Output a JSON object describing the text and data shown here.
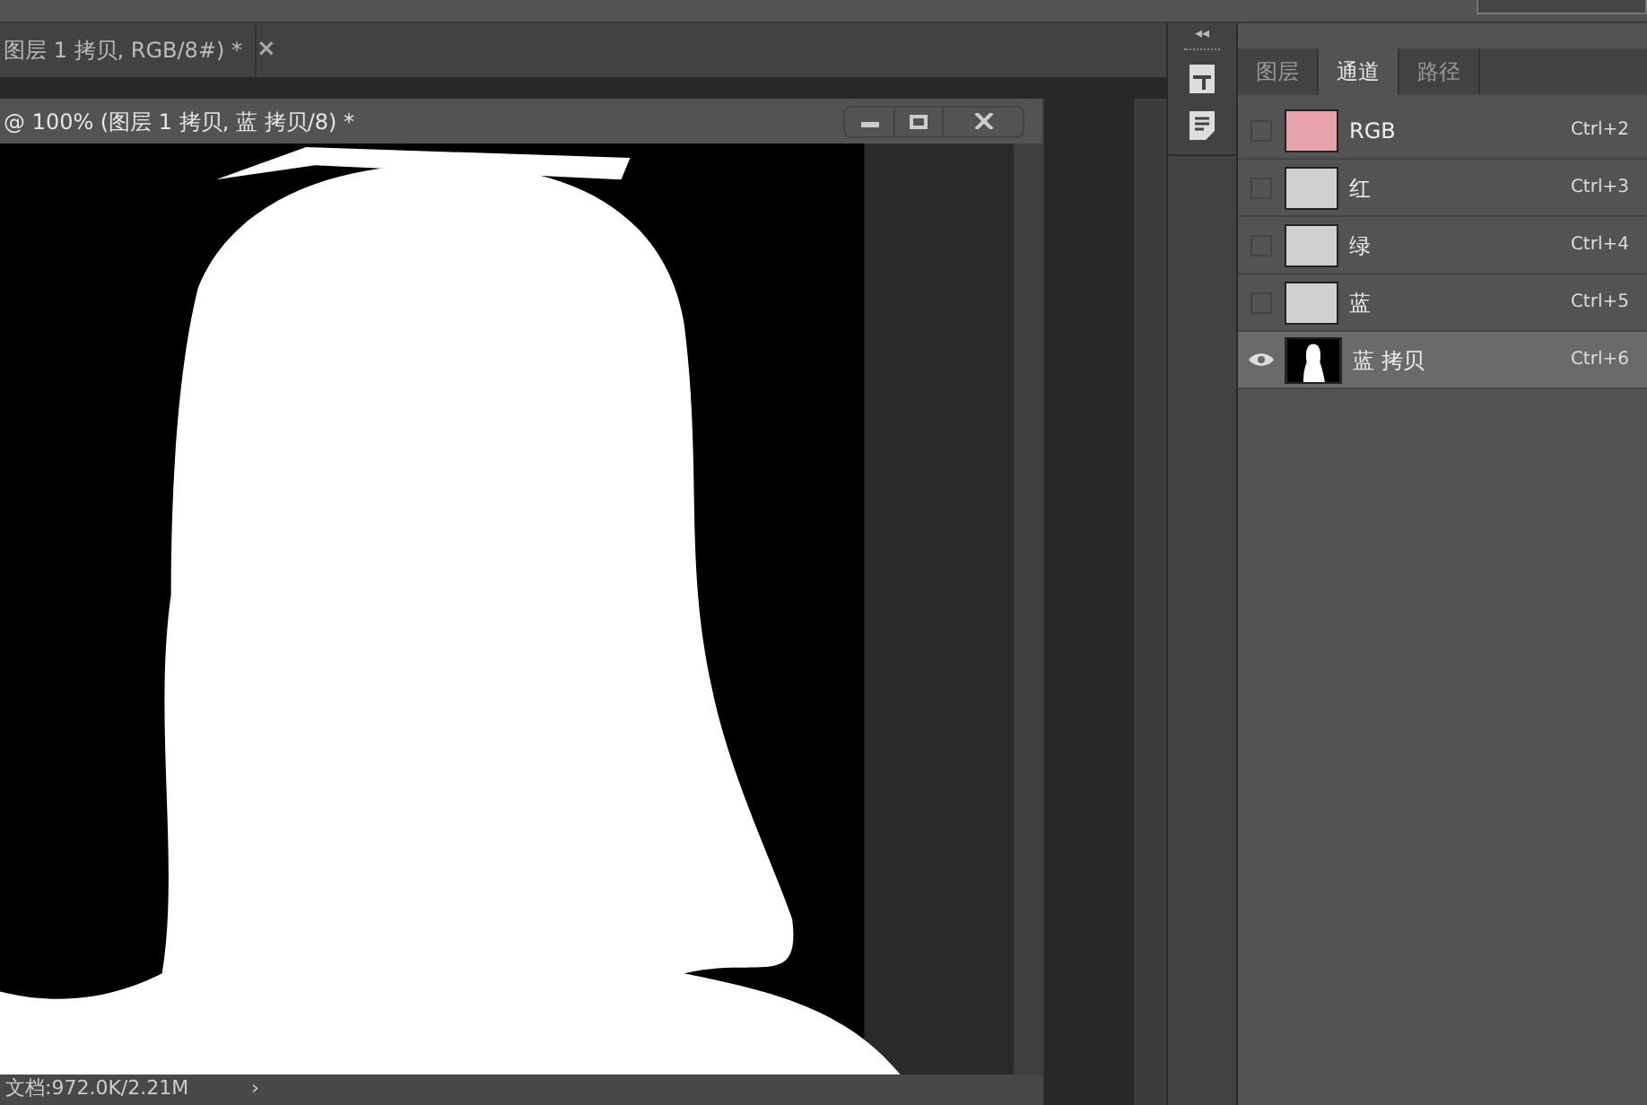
{
  "document_tab": {
    "title": "图层 1 拷贝, RGB/8#) *",
    "close": "×"
  },
  "document_window": {
    "title": "@ 100% (图层 1 拷贝, 蓝 拷贝/8) *"
  },
  "status_bar": {
    "doc_size": "文档:972.0K/2.21M",
    "arrow": "›"
  },
  "panel": {
    "collapse": "◂◂",
    "tabs": [
      {
        "label": "图层",
        "selected": false
      },
      {
        "label": "通道",
        "selected": true
      },
      {
        "label": "路径",
        "selected": false
      }
    ],
    "channels": [
      {
        "name": "RGB",
        "shortcut": "Ctrl+2",
        "visible": false,
        "selected": false,
        "kind": "color"
      },
      {
        "name": "红",
        "shortcut": "Ctrl+3",
        "visible": false,
        "selected": false,
        "kind": "gray"
      },
      {
        "name": "绿",
        "shortcut": "Ctrl+4",
        "visible": false,
        "selected": false,
        "kind": "gray"
      },
      {
        "name": "蓝",
        "shortcut": "Ctrl+5",
        "visible": false,
        "selected": false,
        "kind": "gray"
      },
      {
        "name": "蓝 拷贝",
        "shortcut": "Ctrl+6",
        "visible": true,
        "selected": true,
        "kind": "mask"
      }
    ]
  }
}
